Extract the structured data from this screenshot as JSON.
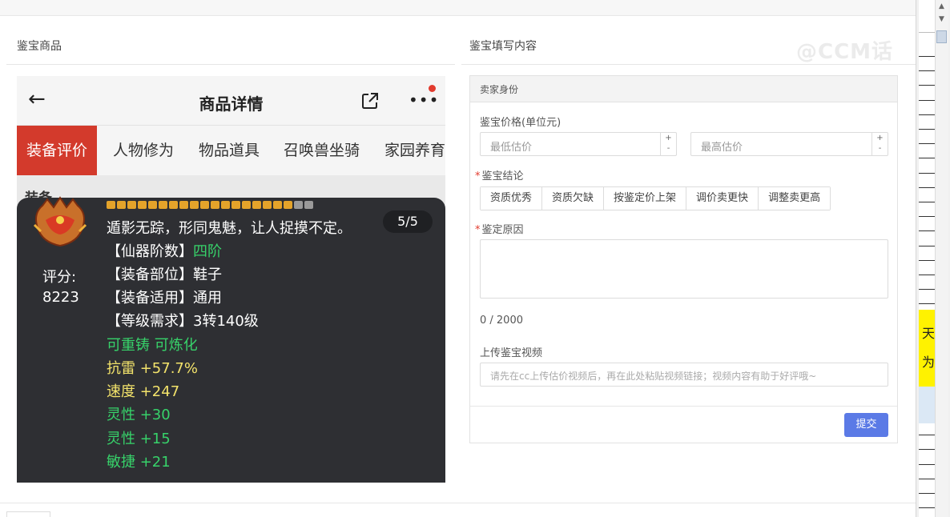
{
  "left_section": {
    "title": "鉴宝商品"
  },
  "right_section": {
    "title": "鉴宝填写内容"
  },
  "watermark": "@CCM话",
  "phone": {
    "back_icon": "←",
    "title": "商品详情",
    "more_icon": "•••",
    "tabs": [
      "装备评价",
      "人物修为",
      "物品道具",
      "召唤兽坐骑",
      "家园养育"
    ],
    "hidden_row": "装备",
    "tooltip": {
      "score_label": "评分:",
      "score_value": "8223",
      "page": "5/5",
      "description": "遁影无踪，形同鬼魅，让人捉摸不定。",
      "lines": [
        {
          "bracket": "【仙器阶数】",
          "value": "四阶"
        },
        {
          "bracket": "【装备部位】",
          "value": "鞋子"
        },
        {
          "bracket": "【装备适用】",
          "value": "通用"
        },
        {
          "bracket": "【等级需求】",
          "value": "3转140级"
        }
      ],
      "refine": "可重铸 可炼化",
      "stats": [
        {
          "label": "抗雷 +57.7%",
          "color": "yellow"
        },
        {
          "label": "速度 +247",
          "color": "yellow"
        },
        {
          "label": "灵性 +30",
          "color": "green"
        },
        {
          "label": "灵性 +15",
          "color": "green"
        },
        {
          "label": "敏捷 +21",
          "color": "green"
        }
      ],
      "stars_gold": 18,
      "stars_grey": 2
    }
  },
  "form": {
    "panel_title": "卖家身份",
    "price_label": "鉴宝价格(单位元)",
    "min_placeholder": "最低估价",
    "max_placeholder": "最高估价",
    "conclusion_label": "鉴宝结论",
    "conclusions": [
      "资质优秀",
      "资质欠缺",
      "按鉴定价上架",
      "调价卖更快",
      "调整卖更高"
    ],
    "reason_label": "鉴定原因",
    "counter": "0 / 2000",
    "video_label": "上传鉴宝视频",
    "video_placeholder": "请先在cc上传估价视频后，再在此处粘贴视频链接；视频内容有助于好评哦~",
    "submit": "提交",
    "spin_up": "+",
    "spin_down": "-"
  },
  "side_sheet": {
    "cell1": "天",
    "cell2": "为"
  }
}
